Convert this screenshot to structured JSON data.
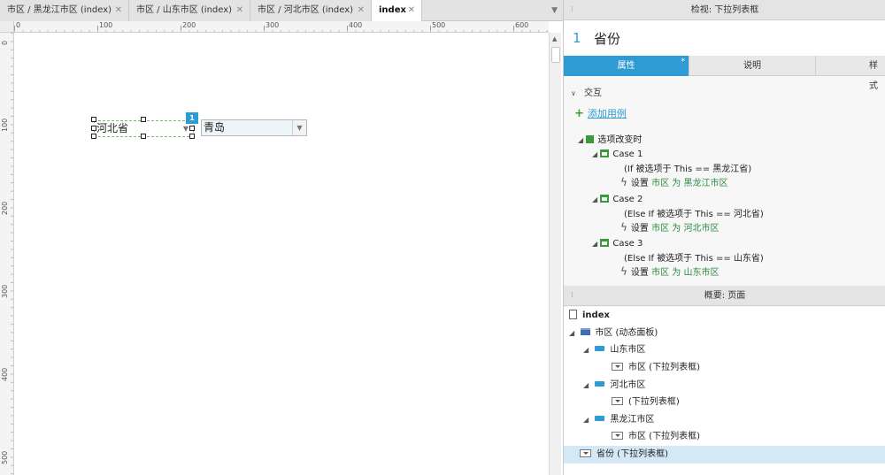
{
  "tabs": [
    {
      "label": "市区 / 黑龙江市区 (index)",
      "close": "✕"
    },
    {
      "label": "市区 / 山东市区 (index)",
      "close": "✕"
    },
    {
      "label": "市区 / 河北市区 (index)",
      "close": "✕"
    },
    {
      "label": "index",
      "close": "✕"
    }
  ],
  "ruler": {
    "h_labels": [
      "0",
      "100",
      "200",
      "300",
      "400",
      "500",
      "600"
    ],
    "v_labels": [
      "0",
      "100",
      "200",
      "300",
      "400",
      "500"
    ]
  },
  "canvas": {
    "province_dropdown_value": "河北省",
    "city_dropdown_value": "青岛",
    "badge": "1",
    "caret": "▼"
  },
  "inspector": {
    "header": "检视: 下拉列表框",
    "widget_number": "1",
    "widget_name": "省份",
    "tabs": [
      "属性",
      "说明",
      "样式"
    ],
    "active_tab_star": "*",
    "section": "交互",
    "add_case": "添加用例",
    "event": "选项改变时",
    "cases": [
      {
        "name": "Case 1",
        "condition": "(If 被选项于 This == 黑龙江省)",
        "action_prefix": "设置",
        "target": "市区",
        "word_to": "为",
        "state": "黑龙江市区"
      },
      {
        "name": "Case 2",
        "condition": "(Else If 被选项于 This == 河北省)",
        "action_prefix": "设置",
        "target": "市区",
        "word_to": "为",
        "state": "河北市区"
      },
      {
        "name": "Case 3",
        "condition": "(Else If 被选项于 This == 山东省)",
        "action_prefix": "设置",
        "target": "市区",
        "word_to": "为",
        "state": "山东市区"
      }
    ]
  },
  "outline": {
    "header": "概要: 页面",
    "page": "index",
    "dynamic_panel": "市区 (动态面板)",
    "states": [
      {
        "name": "山东市区",
        "child": "市区 (下拉列表框)"
      },
      {
        "name": "河北市区",
        "child": "(下拉列表框)"
      },
      {
        "name": "黑龙江市区",
        "child": "市区 (下拉列表框)"
      }
    ],
    "selected_item": "省份 (下拉列表框)"
  },
  "colors": {
    "accent": "#2e9bd5",
    "action_green": "#2b8a3e",
    "selection": "#d4e9f5"
  }
}
